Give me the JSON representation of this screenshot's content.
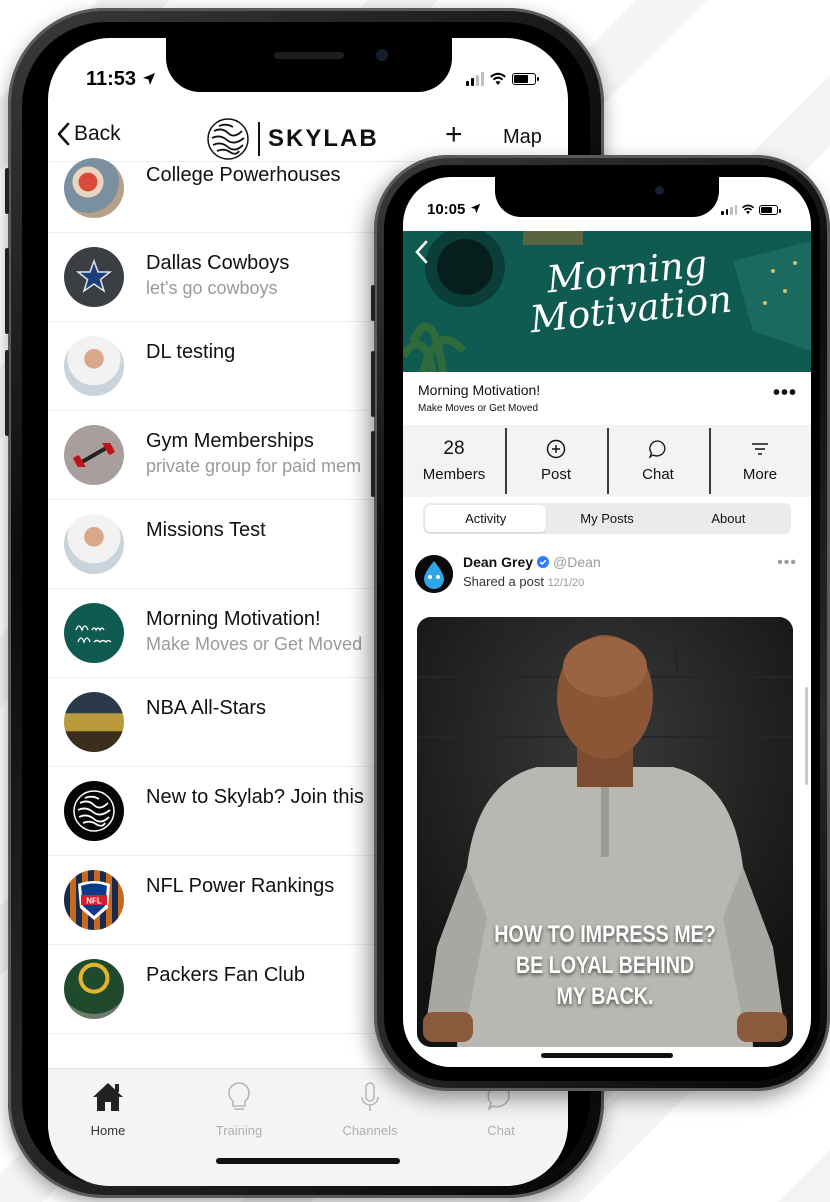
{
  "phone1": {
    "status_time": "11:53",
    "nav": {
      "back_label": "Back",
      "logo_text": "SKYLAB",
      "add_label": "+",
      "map_label": "Map"
    },
    "channels": [
      {
        "title": "College Powerhouses",
        "subtitle": ""
      },
      {
        "title": "Dallas Cowboys",
        "subtitle": "let's go cowboys"
      },
      {
        "title": "DL testing",
        "subtitle": ""
      },
      {
        "title": "Gym Memberships",
        "subtitle": "private group for paid mem"
      },
      {
        "title": "Missions Test",
        "subtitle": ""
      },
      {
        "title": "Morning Motivation!",
        "subtitle": "Make Moves or Get Moved"
      },
      {
        "title": "NBA All-Stars",
        "subtitle": ""
      },
      {
        "title": "New to Skylab? Join this",
        "subtitle": ""
      },
      {
        "title": "NFL Power Rankings",
        "subtitle": ""
      },
      {
        "title": "Packers Fan Club",
        "subtitle": ""
      }
    ],
    "tabs": [
      {
        "label": "Home",
        "icon": "home-icon",
        "active": true
      },
      {
        "label": "Training",
        "icon": "lightbulb-icon",
        "active": false
      },
      {
        "label": "Channels",
        "icon": "microphone-icon",
        "active": false
      },
      {
        "label": "Chat",
        "icon": "chat-icon",
        "active": false
      }
    ]
  },
  "phone2": {
    "status_time": "10:05",
    "hero_title": "Morning Motivation",
    "group": {
      "name": "Morning Motivation!",
      "subtitle": "Make Moves or Get Moved",
      "more_dots": "•••"
    },
    "stats": [
      {
        "value": "28",
        "label": "Members"
      },
      {
        "icon": "plus-circle-icon",
        "label": "Post"
      },
      {
        "icon": "chat-bubble-icon",
        "label": "Chat"
      },
      {
        "icon": "filter-lines-icon",
        "label": "More"
      }
    ],
    "tabs": [
      {
        "label": "Activity",
        "active": true
      },
      {
        "label": "My Posts",
        "active": false
      },
      {
        "label": "About",
        "active": false
      }
    ],
    "post": {
      "author": "Dean Grey",
      "handle": "@Dean",
      "action": "Shared a post",
      "date": "12/1/20",
      "more_dots": "•••",
      "quote_lines": [
        "HOW TO IMPRESS ME?",
        "BE LOYAL BEHIND",
        "MY BACK."
      ]
    }
  },
  "colors": {
    "hero_teal": "#0f5a51",
    "verified_blue": "#2e7cf6",
    "avatar_cowboys": "#3b3f44",
    "avatar_morning": "#0f5a51"
  }
}
